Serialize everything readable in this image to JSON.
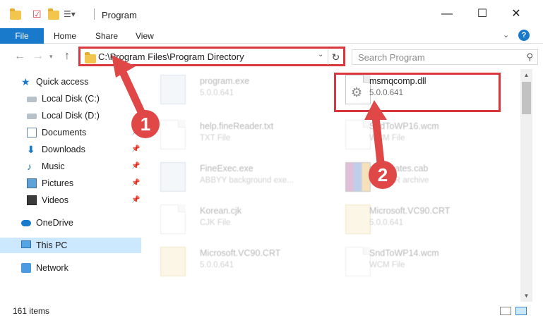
{
  "window": {
    "title": "Program",
    "minimize_label": "—",
    "maximize_label": "☐",
    "close_label": "✕"
  },
  "ribbon": {
    "file_label": "File",
    "tabs": [
      "Home",
      "Share",
      "View"
    ],
    "help_label": "?"
  },
  "address": {
    "path": "C:\\Program Files\\Program Directory",
    "search_placeholder": "Search Program"
  },
  "sidebar": {
    "quick_access": "Quick access",
    "items": [
      {
        "label": "Local Disk (C:)",
        "icon": "drive-icon",
        "pinned": false
      },
      {
        "label": "Local Disk (D:)",
        "icon": "drive-icon",
        "pinned": false
      },
      {
        "label": "Documents",
        "icon": "documents-icon",
        "pinned": true
      },
      {
        "label": "Downloads",
        "icon": "download-icon",
        "pinned": true
      },
      {
        "label": "Music",
        "icon": "music-icon",
        "pinned": true
      },
      {
        "label": "Pictures",
        "icon": "pictures-icon",
        "pinned": true
      },
      {
        "label": "Videos",
        "icon": "videos-icon",
        "pinned": true
      }
    ],
    "onedrive": "OneDrive",
    "this_pc": "This PC",
    "network": "Network"
  },
  "files": [
    {
      "name": "program.exe",
      "sub": "5.0.0.641",
      "icon": "exe-icon",
      "faded": true
    },
    {
      "name": "msmqcomp.dll",
      "sub": "5.0.0.641",
      "icon": "dll-icon",
      "faded": false
    },
    {
      "name": "help.fineReader.txt",
      "sub": "TXT File",
      "icon": "text-file-icon",
      "faded": true
    },
    {
      "name": "SndToWP16.wcm",
      "sub": "WCM File",
      "icon": "file-icon",
      "faded": true
    },
    {
      "name": "FineExec.exe",
      "sub": "ABBYY background exe...",
      "icon": "exe-icon",
      "faded": true
    },
    {
      "name": "certificates.cab",
      "sub": "WinRAR archive",
      "icon": "archive-icon",
      "faded": true
    },
    {
      "name": "Korean.cjk",
      "sub": "CJK File",
      "icon": "file-icon",
      "faded": true
    },
    {
      "name": "Microsoft.VC90.CRT",
      "sub": "5.0.0.641",
      "icon": "config-icon",
      "faded": true
    },
    {
      "name": "Microsoft.VC90.CRT",
      "sub": "5.0.0.641",
      "icon": "config-icon",
      "faded": true
    },
    {
      "name": "SndToWP14.wcm",
      "sub": "WCM File",
      "icon": "file-icon",
      "faded": true
    }
  ],
  "status": {
    "item_count": "161 items"
  },
  "annotations": {
    "step1": "1",
    "step2": "2",
    "color": "#e04848"
  }
}
